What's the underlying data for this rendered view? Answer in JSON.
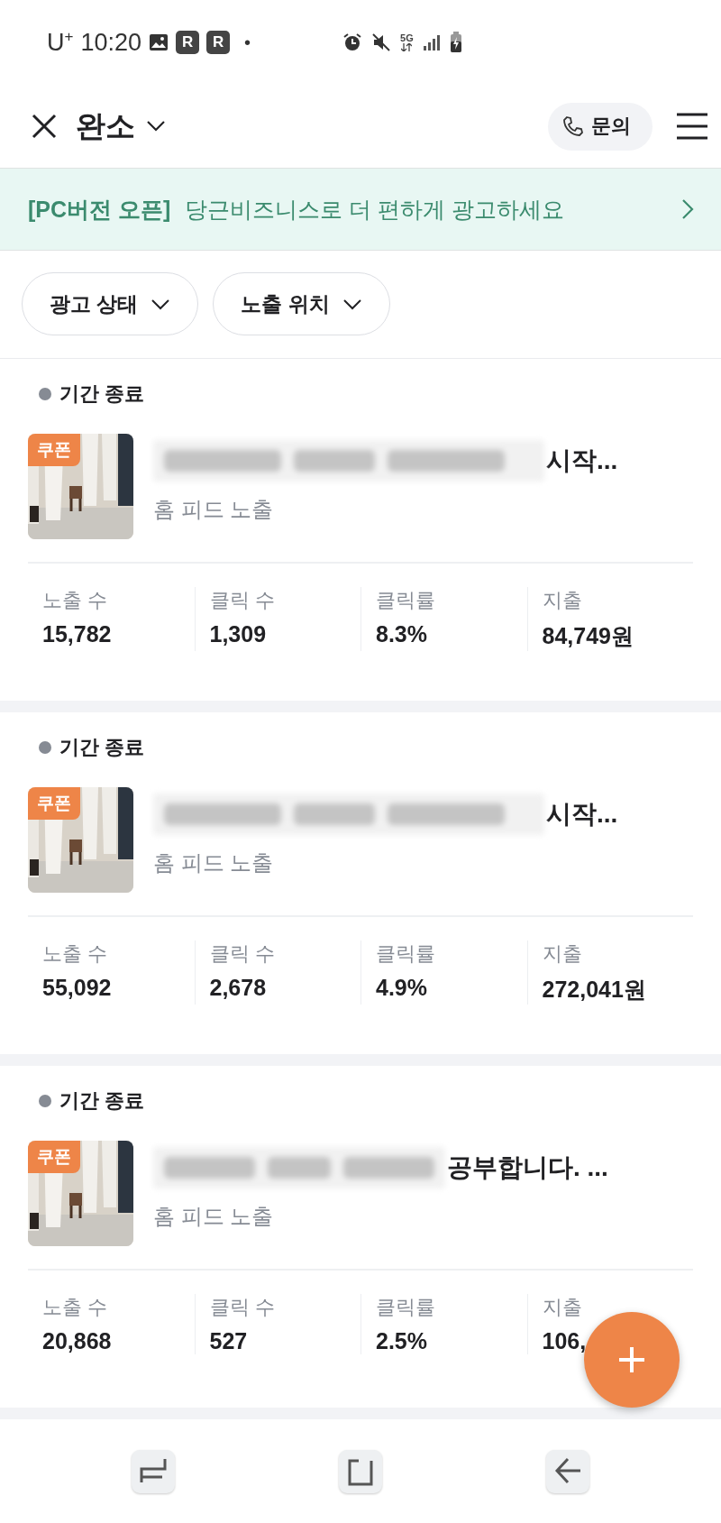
{
  "status_bar": {
    "carrier": "U$^{+}$",
    "time": "10:20",
    "badges": [
      "R",
      "R"
    ],
    "dot": "•",
    "network": "5G"
  },
  "header": {
    "title": "완소",
    "inquiry_button": "문의"
  },
  "banner": {
    "highlight": "[PC버전 오픈]",
    "text": "당근비즈니스로 더 편하게 광고하세요"
  },
  "filters": [
    {
      "label": "광고 상태"
    },
    {
      "label": "노출 위치"
    }
  ],
  "ads": [
    {
      "status": "기간 종료",
      "badge": "쿠폰",
      "title_visible": "시작...",
      "placement": "홈 피드 노출",
      "metrics": [
        {
          "label": "노출 수",
          "value": "15,782"
        },
        {
          "label": "클릭 수",
          "value": "1,309"
        },
        {
          "label": "클릭률",
          "value": "8.3%"
        },
        {
          "label": "지출",
          "value": "84,749원"
        }
      ]
    },
    {
      "status": "기간 종료",
      "badge": "쿠폰",
      "title_visible": "시작...",
      "placement": "홈 피드 노출",
      "metrics": [
        {
          "label": "노출 수",
          "value": "55,092"
        },
        {
          "label": "클릭 수",
          "value": "2,678"
        },
        {
          "label": "클릭률",
          "value": "4.9%"
        },
        {
          "label": "지출",
          "value": "272,041원"
        }
      ]
    },
    {
      "status": "기간 종료",
      "badge": "쿠폰",
      "title_visible": "공부합니다. ...",
      "placement": "홈 피드 노출",
      "metrics": [
        {
          "label": "노출 수",
          "value": "20,868"
        },
        {
          "label": "클릭 수",
          "value": "527"
        },
        {
          "label": "클릭률",
          "value": "2.5%"
        },
        {
          "label": "지출",
          "value": "106,"
        }
      ]
    }
  ]
}
